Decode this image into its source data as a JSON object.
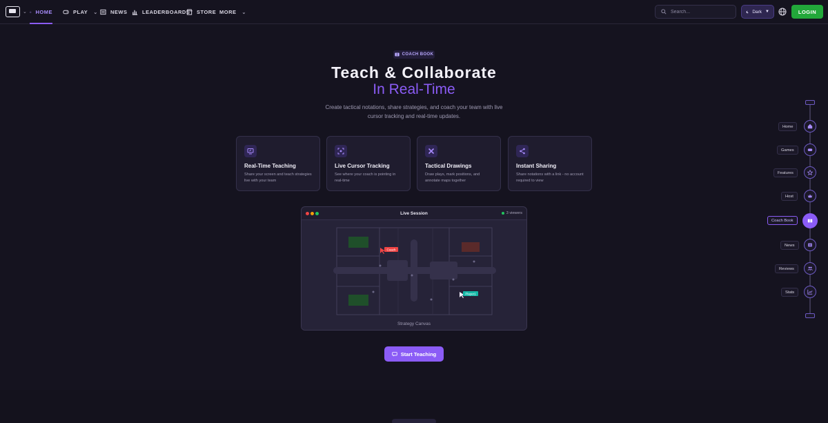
{
  "nav": {
    "items": [
      {
        "label": "HOME",
        "icon": "home-icon"
      },
      {
        "label": "PLAY",
        "icon": "gamepad-icon"
      },
      {
        "label": "NEWS",
        "icon": "newspaper-icon"
      },
      {
        "label": "LEADERBOARDS",
        "icon": "bar-chart-icon"
      },
      {
        "label": "STORE",
        "icon": "store-icon"
      },
      {
        "label": "MORE",
        "icon": ""
      }
    ],
    "search_placeholder": "Search...",
    "theme_label": "Dark",
    "login_label": "LOGIN"
  },
  "hero": {
    "tag": "COACH BOOK",
    "title_line1": "Teach & Collaborate",
    "title_line2": "In Real-Time",
    "subtitle": "Create tactical notations, share strategies, and coach your team with live cursor tracking and real-time updates."
  },
  "features": [
    {
      "title": "Real-Time Teaching",
      "text": "Share your screen and teach strategies live with your team",
      "icon": "screen-share-icon"
    },
    {
      "title": "Live Cursor Tracking",
      "text": "See where your coach is pointing in real-time",
      "icon": "cursor-track-icon"
    },
    {
      "title": "Tactical Drawings",
      "text": "Draw plays, mark positions, and annotate maps together",
      "icon": "pencil-ruler-icon"
    },
    {
      "title": "Instant Sharing",
      "text": "Share notations with a link - no account required to view",
      "icon": "share-icon"
    }
  ],
  "session": {
    "title": "Live Session",
    "viewers": "3 viewers",
    "canvas_label": "Strategy Canvas",
    "cursor_coach": "Coach",
    "cursor_player": "Player1"
  },
  "cta": {
    "label": "Start Teaching"
  },
  "sidenav": {
    "items": [
      {
        "label": "Home",
        "icon": "home-icon"
      },
      {
        "label": "Games",
        "icon": "gamepad-icon"
      },
      {
        "label": "Features",
        "icon": "star-icon"
      },
      {
        "label": "Host",
        "icon": "crown-icon"
      },
      {
        "label": "Coach Book",
        "icon": "book-icon",
        "active": true
      },
      {
        "label": "News",
        "icon": "newspaper-icon"
      },
      {
        "label": "Reviews",
        "icon": "users-icon"
      },
      {
        "label": "Stats",
        "icon": "trend-icon"
      }
    ]
  },
  "colors": {
    "accent": "#8b5cf6",
    "login": "#22a83a",
    "background": "#15131f"
  }
}
